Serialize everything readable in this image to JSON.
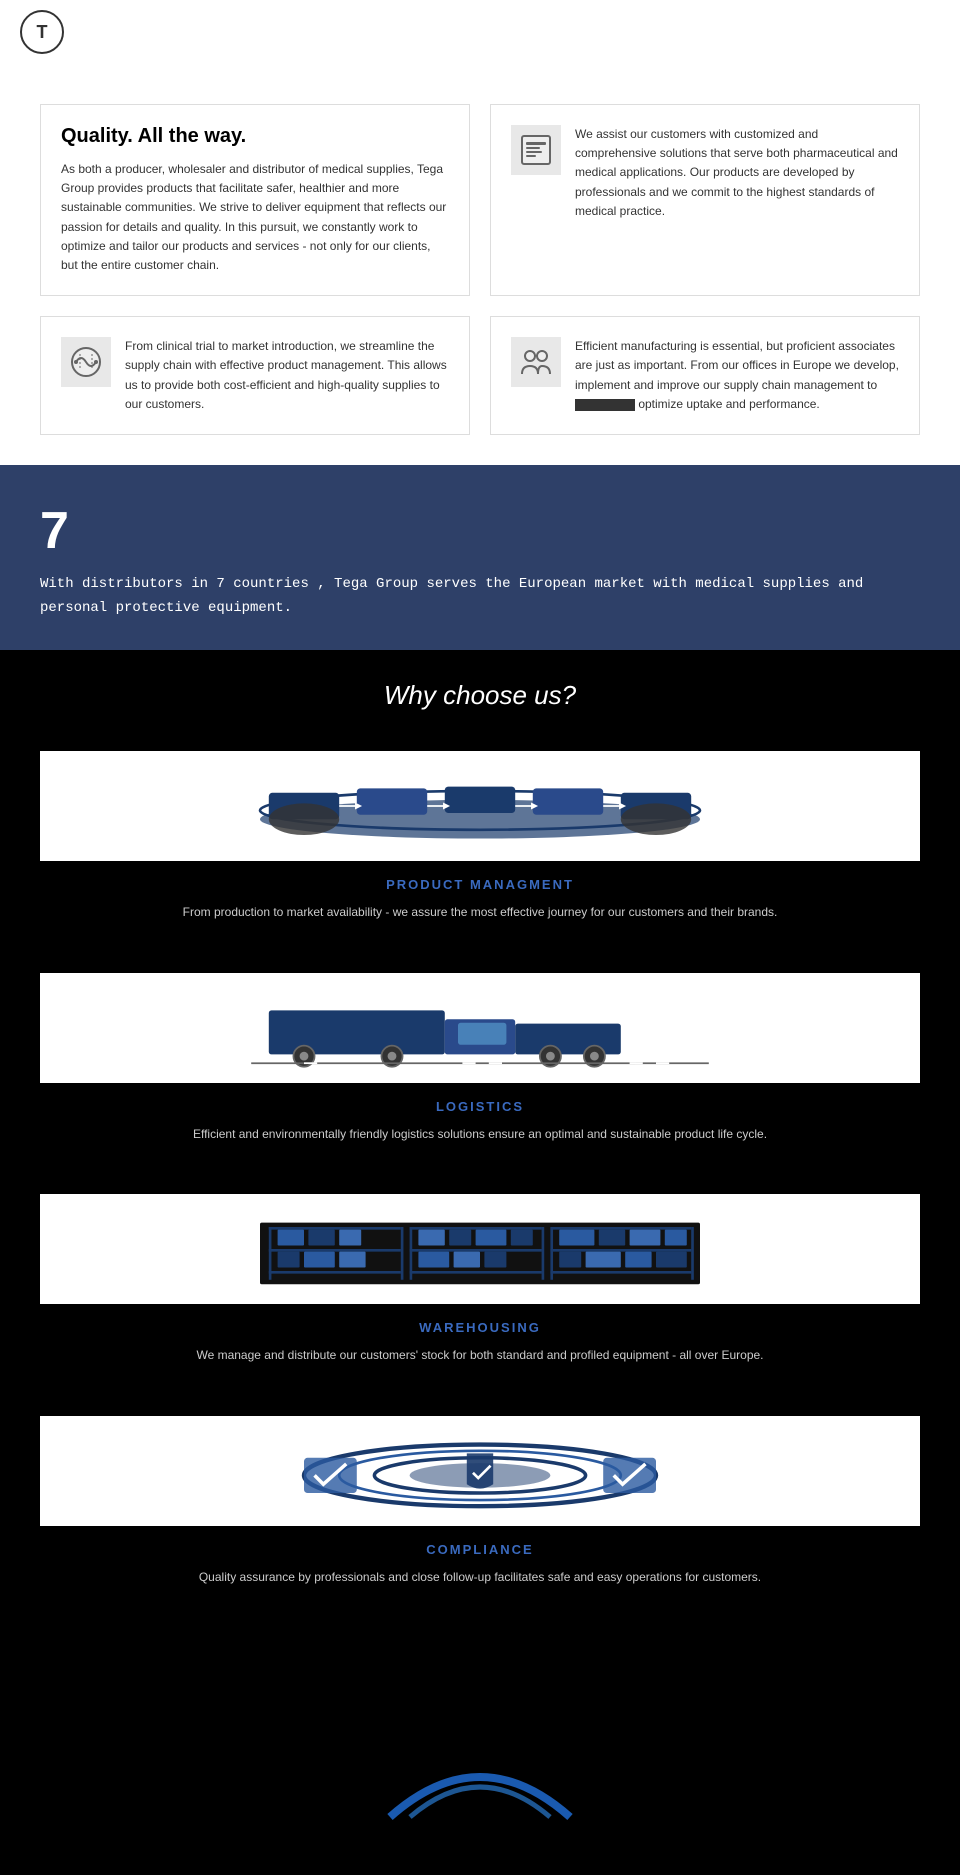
{
  "header": {
    "logo_text": "T"
  },
  "quality": {
    "title": "Quality.  All the way.",
    "main_text": "As both a producer, wholesaler and distributor of medical supplies, Tega Group provides products that facilitate safer, healthier and more sustainable communities. We strive to deliver equipment that reflects our passion for details and quality. In this pursuit, we constantly work to optimize and tailor our products and services - not only for our clients, but the entire customer chain.",
    "card1_text": "We assist our customers with customized and comprehensive solutions that serve both pharmaceutical and medical applications. Our products are developed by professionals and we commit to the highest standards of medical practice.",
    "card2_text": "From clinical trial to market introduction, we streamline the supply chain with effective product management. This allows us to provide both cost-efficient and high-quality supplies to our customers.",
    "card3_text": "Efficient manufacturing is essential, but proficient associates are just as important. From our offices in Europe we develop, implement and improve our supply chain management to optimize uptake and performance."
  },
  "stats": {
    "number": "7",
    "text": "With distributors in 7 countries , Tega Group serves the European market with medical supplies and\npersonal protective equipment."
  },
  "why": {
    "title": "Why choose us?",
    "services": [
      {
        "title": "PRODUCT MANAGMENT",
        "desc": "From production to market availability - we assure the most effective journey for our customers and their brands."
      },
      {
        "title": "LOGISTICS",
        "desc": "Efficient and environmentally friendly logistics solutions ensure an optimal and sustainable product life cycle."
      },
      {
        "title": "WAREHOUSING",
        "desc": "We manage and distribute our customers' stock for both standard and profiled equipment - all over Europe."
      },
      {
        "title": "COMPLIANCE",
        "desc": "Quality assurance by professionals and close follow-up facilitates safe and easy operations for customers."
      }
    ]
  }
}
